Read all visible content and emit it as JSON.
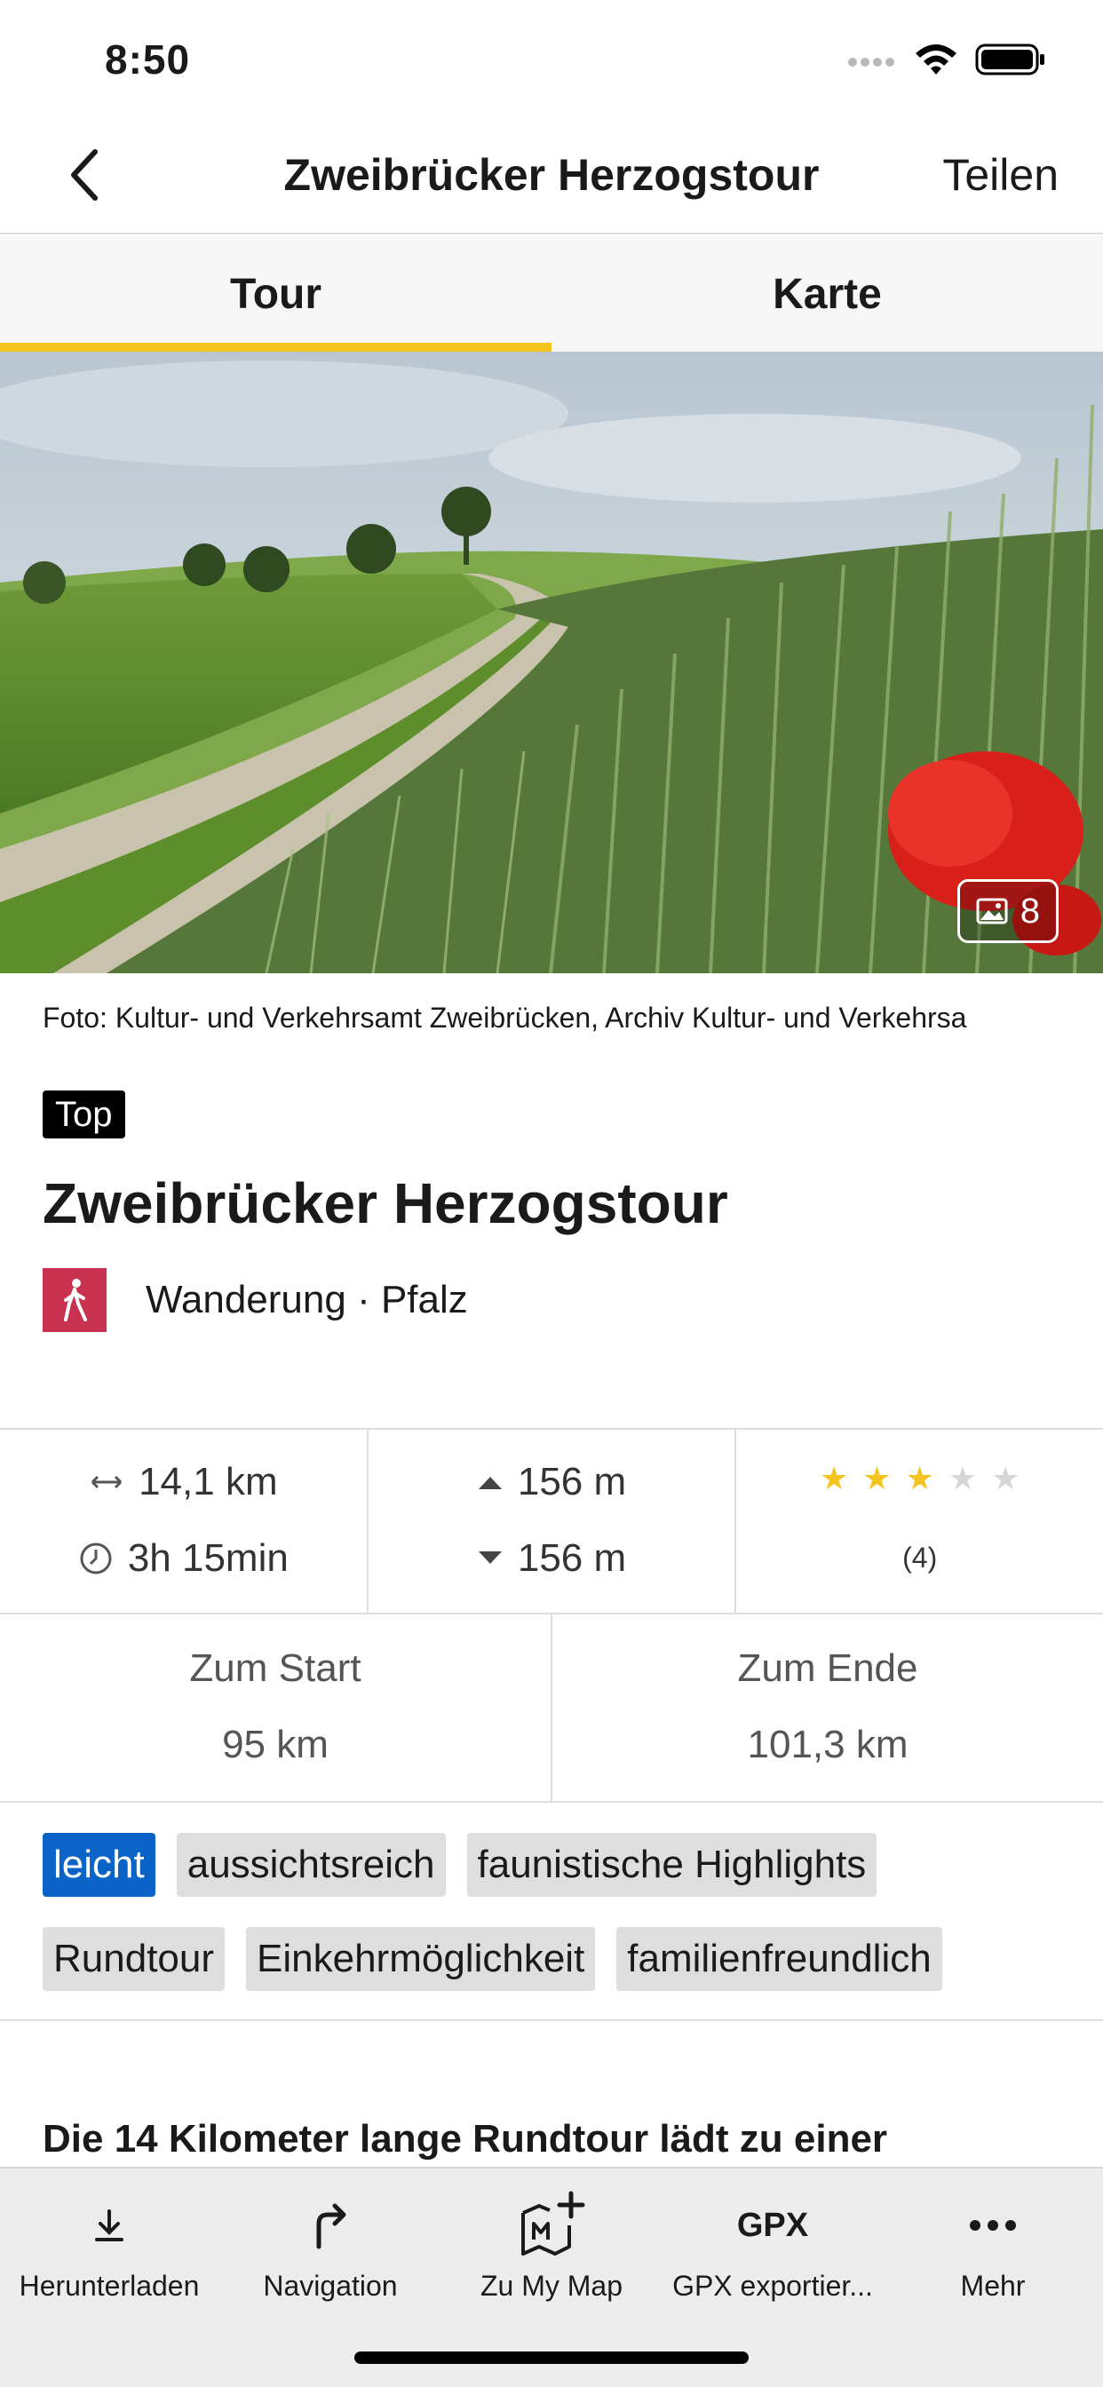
{
  "status": {
    "time": "8:50"
  },
  "nav": {
    "title": "Zweibrücker Herzogstour",
    "share": "Teilen"
  },
  "tabs": [
    {
      "label": "Tour",
      "active": true
    },
    {
      "label": "Karte",
      "active": false
    }
  ],
  "hero": {
    "photo_count": "8"
  },
  "caption": "Foto: Kultur- und Verkehrsamt Zweibrücken, Archiv Kultur- und Verkehrsa",
  "badge": "Top",
  "tour": {
    "title": "Zweibrücker Herzogstour",
    "type_location": "Wanderung · Pfalz",
    "type_color": "#c8324e"
  },
  "stats": {
    "distance": "14,1 km",
    "duration": "3h 15min",
    "ascent": "156 m",
    "descent": "156 m",
    "rating": 3,
    "rating_max": 5,
    "rating_count": "(4)"
  },
  "distances": {
    "start_label": "Zum Start",
    "start_value": "95 km",
    "end_label": "Zum Ende",
    "end_value": "101,3 km"
  },
  "tags": {
    "row1": [
      "leicht",
      "aussichtsreich",
      "faunistische Highlights"
    ],
    "row2": [
      "Rundtour",
      "Einkehrmöglichkeit",
      "familienfreundlich"
    ]
  },
  "description_start": "Die 14 Kilometer lange Rundtour lädt zu einer",
  "toolbar": {
    "download": "Herunterladen",
    "navigation": "Navigation",
    "my_map": "Zu My Map",
    "gpx": "GPX exportier...",
    "gpx_icon": "GPX",
    "more": "Mehr"
  },
  "colors": {
    "accent": "#f4c51f",
    "primary": "#0a64c8",
    "hiking": "#c8324e"
  }
}
